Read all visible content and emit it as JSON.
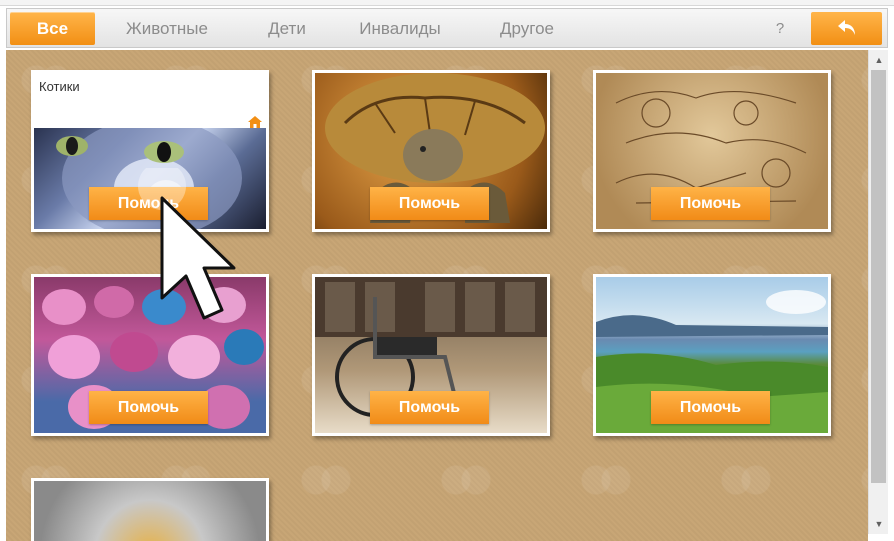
{
  "nav": {
    "tabs": [
      {
        "label": "Все",
        "active": true
      },
      {
        "label": "Животные",
        "active": false
      },
      {
        "label": "Дети",
        "active": false
      },
      {
        "label": "Инвалиды",
        "active": false
      },
      {
        "label": "Другое",
        "active": false
      }
    ],
    "help_label": "?",
    "back_icon": "back-arrow-icon"
  },
  "cards": [
    {
      "title": "Котики",
      "button": "Помочь",
      "icon": "home-icon"
    },
    {
      "button": "Помочь"
    },
    {
      "button": "Помочь"
    },
    {
      "button": "Помочь"
    },
    {
      "button": "Помочь"
    },
    {
      "button": "Помочь"
    }
  ],
  "colors": {
    "accent": "#f28f14",
    "background": "#c8a676"
  }
}
